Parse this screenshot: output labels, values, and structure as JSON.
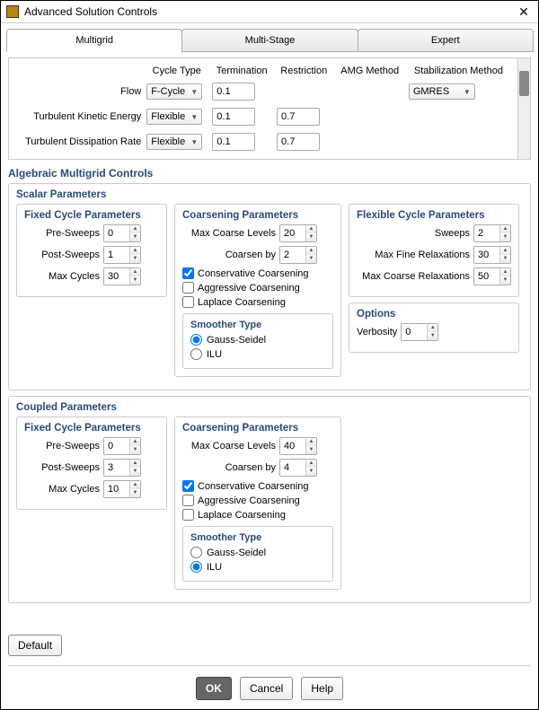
{
  "window": {
    "title": "Advanced Solution Controls"
  },
  "tabs": {
    "multigrid": "Multigrid",
    "multistage": "Multi-Stage",
    "expert": "Expert"
  },
  "top": {
    "headers": {
      "cycle": "Cycle Type",
      "term": "Termination",
      "restr": "Restriction",
      "amg": "AMG Method",
      "stab": "Stabilization Method"
    },
    "rows": {
      "flow": {
        "label": "Flow",
        "cycle": "F-Cycle",
        "term": "0.1",
        "stab": "GMRES"
      },
      "tke": {
        "label": "Turbulent Kinetic Energy",
        "cycle": "Flexible",
        "term": "0.1",
        "restr": "0.7"
      },
      "tdr": {
        "label": "Turbulent Dissipation Rate",
        "cycle": "Flexible",
        "term": "0.1",
        "restr": "0.7"
      }
    }
  },
  "amc_title": "Algebraic Multigrid Controls",
  "scalar": {
    "title": "Scalar Parameters",
    "fixed": {
      "legend": "Fixed Cycle Parameters",
      "pre": {
        "label": "Pre-Sweeps",
        "val": "0"
      },
      "post": {
        "label": "Post-Sweeps",
        "val": "1"
      },
      "max": {
        "label": "Max Cycles",
        "val": "30"
      }
    },
    "coarsen": {
      "legend": "Coarsening Parameters",
      "maxlvl": {
        "label": "Max Coarse Levels",
        "val": "20"
      },
      "by": {
        "label": "Coarsen by",
        "val": "2"
      },
      "cons": {
        "label": "Conservative Coarsening",
        "checked": true
      },
      "aggr": {
        "label": "Aggressive Coarsening",
        "checked": false
      },
      "lap": {
        "label": "Laplace Coarsening",
        "checked": false
      },
      "smoother": {
        "legend": "Smoother Type",
        "gs": "Gauss-Seidel",
        "ilu": "ILU",
        "selected": "gs"
      }
    },
    "flex": {
      "legend": "Flexible Cycle Parameters",
      "sweeps": {
        "label": "Sweeps",
        "val": "2"
      },
      "fine": {
        "label": "Max Fine Relaxations",
        "val": "30"
      },
      "coarse": {
        "label": "Max Coarse Relaxations",
        "val": "50"
      }
    },
    "options": {
      "legend": "Options",
      "verb": {
        "label": "Verbosity",
        "val": "0"
      }
    }
  },
  "coupled": {
    "title": "Coupled Parameters",
    "fixed": {
      "legend": "Fixed Cycle Parameters",
      "pre": {
        "label": "Pre-Sweeps",
        "val": "0"
      },
      "post": {
        "label": "Post-Sweeps",
        "val": "3"
      },
      "max": {
        "label": "Max Cycles",
        "val": "10"
      }
    },
    "coarsen": {
      "legend": "Coarsening Parameters",
      "maxlvl": {
        "label": "Max Coarse Levels",
        "val": "40"
      },
      "by": {
        "label": "Coarsen by",
        "val": "4"
      },
      "cons": {
        "label": "Conservative Coarsening",
        "checked": true
      },
      "aggr": {
        "label": "Aggressive Coarsening",
        "checked": false
      },
      "lap": {
        "label": "Laplace Coarsening",
        "checked": false
      },
      "smoother": {
        "legend": "Smoother Type",
        "gs": "Gauss-Seidel",
        "ilu": "ILU",
        "selected": "ilu"
      }
    }
  },
  "buttons": {
    "default": "Default",
    "ok": "OK",
    "cancel": "Cancel",
    "help": "Help"
  }
}
